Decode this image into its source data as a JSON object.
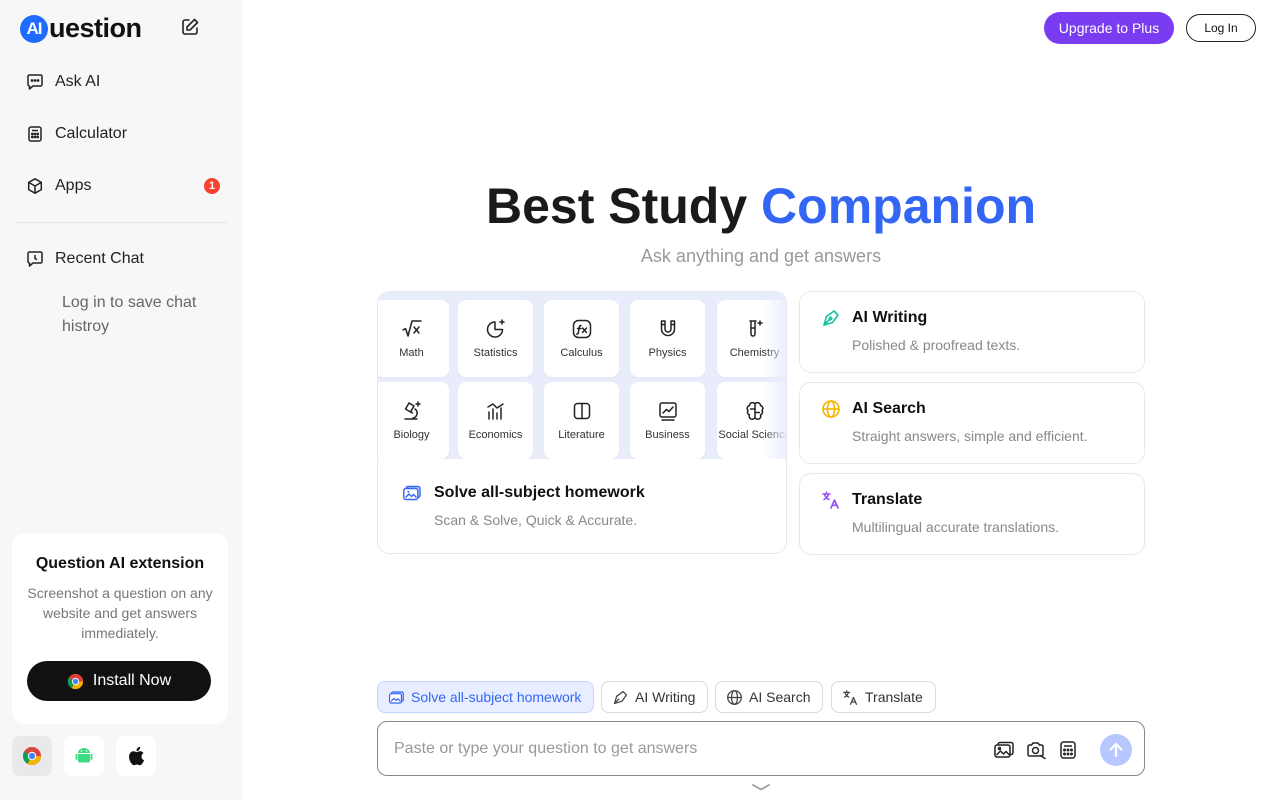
{
  "brand": {
    "logo_badge": "AI",
    "logo_text": "uestion"
  },
  "sidebar": {
    "nav": [
      {
        "label": "Ask AI",
        "icon": "chat-icon"
      },
      {
        "label": "Calculator",
        "icon": "calculator-icon"
      },
      {
        "label": "Apps",
        "icon": "cube-icon",
        "badge": "1"
      }
    ],
    "recent": {
      "label": "Recent Chat",
      "hint": "Log in to save chat histroy"
    },
    "extension": {
      "title": "Question AI extension",
      "description": "Screenshot a question on any website and get answers immediately.",
      "install_label": "Install Now"
    },
    "stores": [
      "chrome-icon",
      "android-icon",
      "apple-icon"
    ]
  },
  "header": {
    "upgrade_label": "Upgrade to Plus",
    "login_label": "Log In"
  },
  "hero": {
    "title_main": "Best Study",
    "title_accent": "Companion",
    "subtitle": "Ask anything and get answers"
  },
  "subjects": {
    "items": [
      "Math",
      "Statistics",
      "Calculus",
      "Physics",
      "Chemistry",
      "Biology",
      "Economics",
      "Literature",
      "Business",
      "Social Science"
    ],
    "card_title": "Solve all-subject homework",
    "card_desc": "Scan & Solve, Quick & Accurate."
  },
  "features": [
    {
      "title": "AI Writing",
      "desc": "Polished & proofread texts.",
      "icon": "pen-icon",
      "color": "#13c2a3"
    },
    {
      "title": "AI Search",
      "desc": "Straight answers, simple and efficient.",
      "icon": "globe-icon",
      "color": "#f5b400"
    },
    {
      "title": "Translate",
      "desc": "Multilingual accurate translations.",
      "icon": "translate-icon",
      "color": "#9a4cf5"
    }
  ],
  "chips": [
    {
      "label": "Solve all-subject homework",
      "active": true
    },
    {
      "label": "AI Writing",
      "active": false
    },
    {
      "label": "AI Search",
      "active": false
    },
    {
      "label": "Translate",
      "active": false
    }
  ],
  "ask": {
    "placeholder": "Paste or type your question to get answers"
  },
  "colors": {
    "accent": "#3366f5",
    "upgrade": "#7a3cf0",
    "badge": "#f5432f"
  }
}
